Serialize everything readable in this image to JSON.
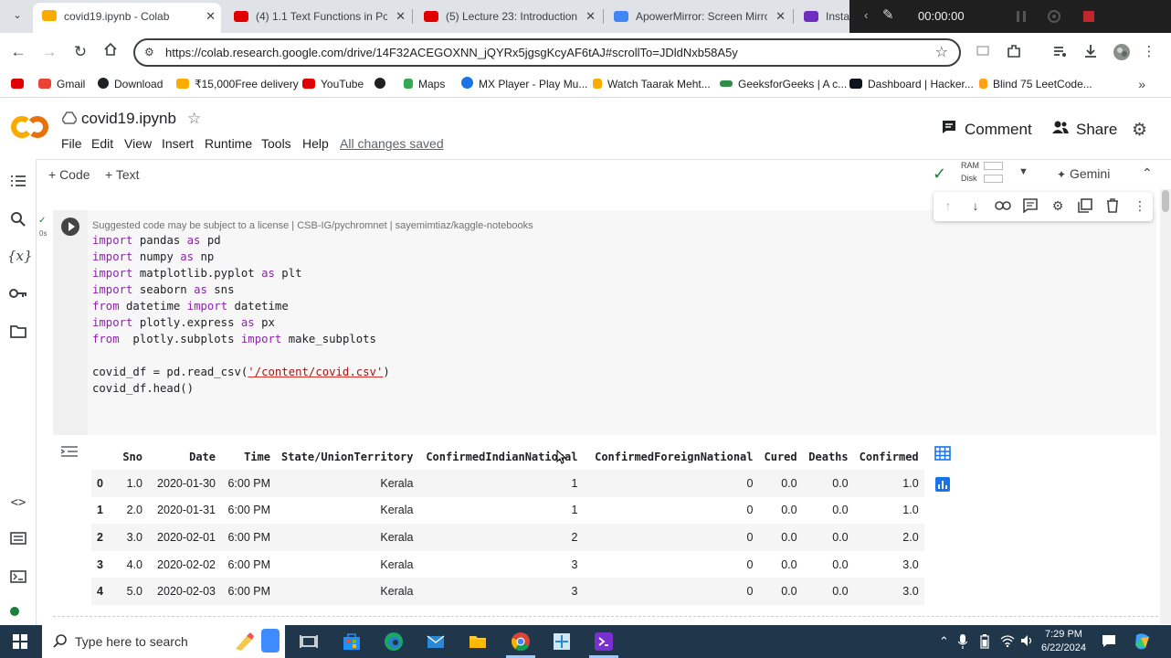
{
  "tabs": [
    {
      "title": "covid19.ipynb - Colab",
      "active": true,
      "favicon_color": "#f9ab00"
    },
    {
      "title": "(4) 1.1 Text Functions in Pow",
      "active": false,
      "favicon_color": "#e00000"
    },
    {
      "title": "(5) Lecture 23: Introduction",
      "active": false,
      "favicon_color": "#e00000"
    },
    {
      "title": "ApowerMirror: Screen Mirro",
      "active": false,
      "favicon_color": "#4285f4"
    },
    {
      "title": "Install",
      "active": false,
      "favicon_color": "#6f2dbd"
    }
  ],
  "recorder": {
    "time": "00:00:00"
  },
  "address_bar": {
    "url": "https://colab.research.google.com/drive/14F32ACEGOXNN_jQYRx5jgsgKcyAF6tAJ#scrollTo=JDldNxb58A5y"
  },
  "bookmarks": [
    {
      "label": "Gmail",
      "color": "#ea4335"
    },
    {
      "label": "Download",
      "color": "#202124"
    },
    {
      "label": "₹15,000Free delivery",
      "color": "#f9ab00"
    },
    {
      "label": "YouTube",
      "color": "#e00000"
    },
    {
      "label": "",
      "color": "#202124"
    },
    {
      "label": "Maps",
      "color": "#34a853"
    },
    {
      "label": "MX Player - Play Mu...",
      "color": "#1a73e8"
    },
    {
      "label": "Watch Taarak Meht...",
      "color": "#f9ab00"
    },
    {
      "label": "GeeksforGeeks | A c...",
      "color": "#2f8d46"
    },
    {
      "label": "Dashboard | Hacker...",
      "color": "#0e141e"
    },
    {
      "label": "Blind 75 LeetCode...",
      "color": "#ffa116"
    }
  ],
  "notebook": {
    "title": "covid19.ipynb",
    "menu": [
      "File",
      "Edit",
      "View",
      "Insert",
      "Runtime",
      "Tools",
      "Help"
    ],
    "save_status": "All changes saved",
    "comment_label": "Comment",
    "share_label": "Share"
  },
  "toolbar": {
    "add_code": "+ Code",
    "add_text": "+ Text",
    "ram_label": "RAM",
    "disk_label": "Disk",
    "gemini_label": "Gemini"
  },
  "cell": {
    "exec_time": "0s",
    "license_note": "Suggested code may be subject to a license | CSB-IG/pychromnet | sayemimtiaz/kaggle-notebooks"
  },
  "dataframe": {
    "columns": [
      "",
      "Sno",
      "Date",
      "Time",
      "State/UnionTerritory",
      "ConfirmedIndianNational",
      "ConfirmedForeignNational",
      "Cured",
      "Deaths",
      "Confirmed"
    ],
    "rows": [
      [
        "0",
        "1.0",
        "2020-01-30",
        "6:00 PM",
        "Kerala",
        "1",
        "0",
        "0.0",
        "0.0",
        "1.0"
      ],
      [
        "1",
        "2.0",
        "2020-01-31",
        "6:00 PM",
        "Kerala",
        "1",
        "0",
        "0.0",
        "0.0",
        "1.0"
      ],
      [
        "2",
        "3.0",
        "2020-02-01",
        "6:00 PM",
        "Kerala",
        "2",
        "0",
        "0.0",
        "0.0",
        "2.0"
      ],
      [
        "3",
        "4.0",
        "2020-02-02",
        "6:00 PM",
        "Kerala",
        "3",
        "0",
        "0.0",
        "0.0",
        "3.0"
      ],
      [
        "4",
        "5.0",
        "2020-02-03",
        "6:00 PM",
        "Kerala",
        "3",
        "0",
        "0.0",
        "0.0",
        "3.0"
      ]
    ]
  },
  "taskbar": {
    "search_placeholder": "Type here to search",
    "time": "7:29 PM",
    "date": "6/22/2024"
  }
}
